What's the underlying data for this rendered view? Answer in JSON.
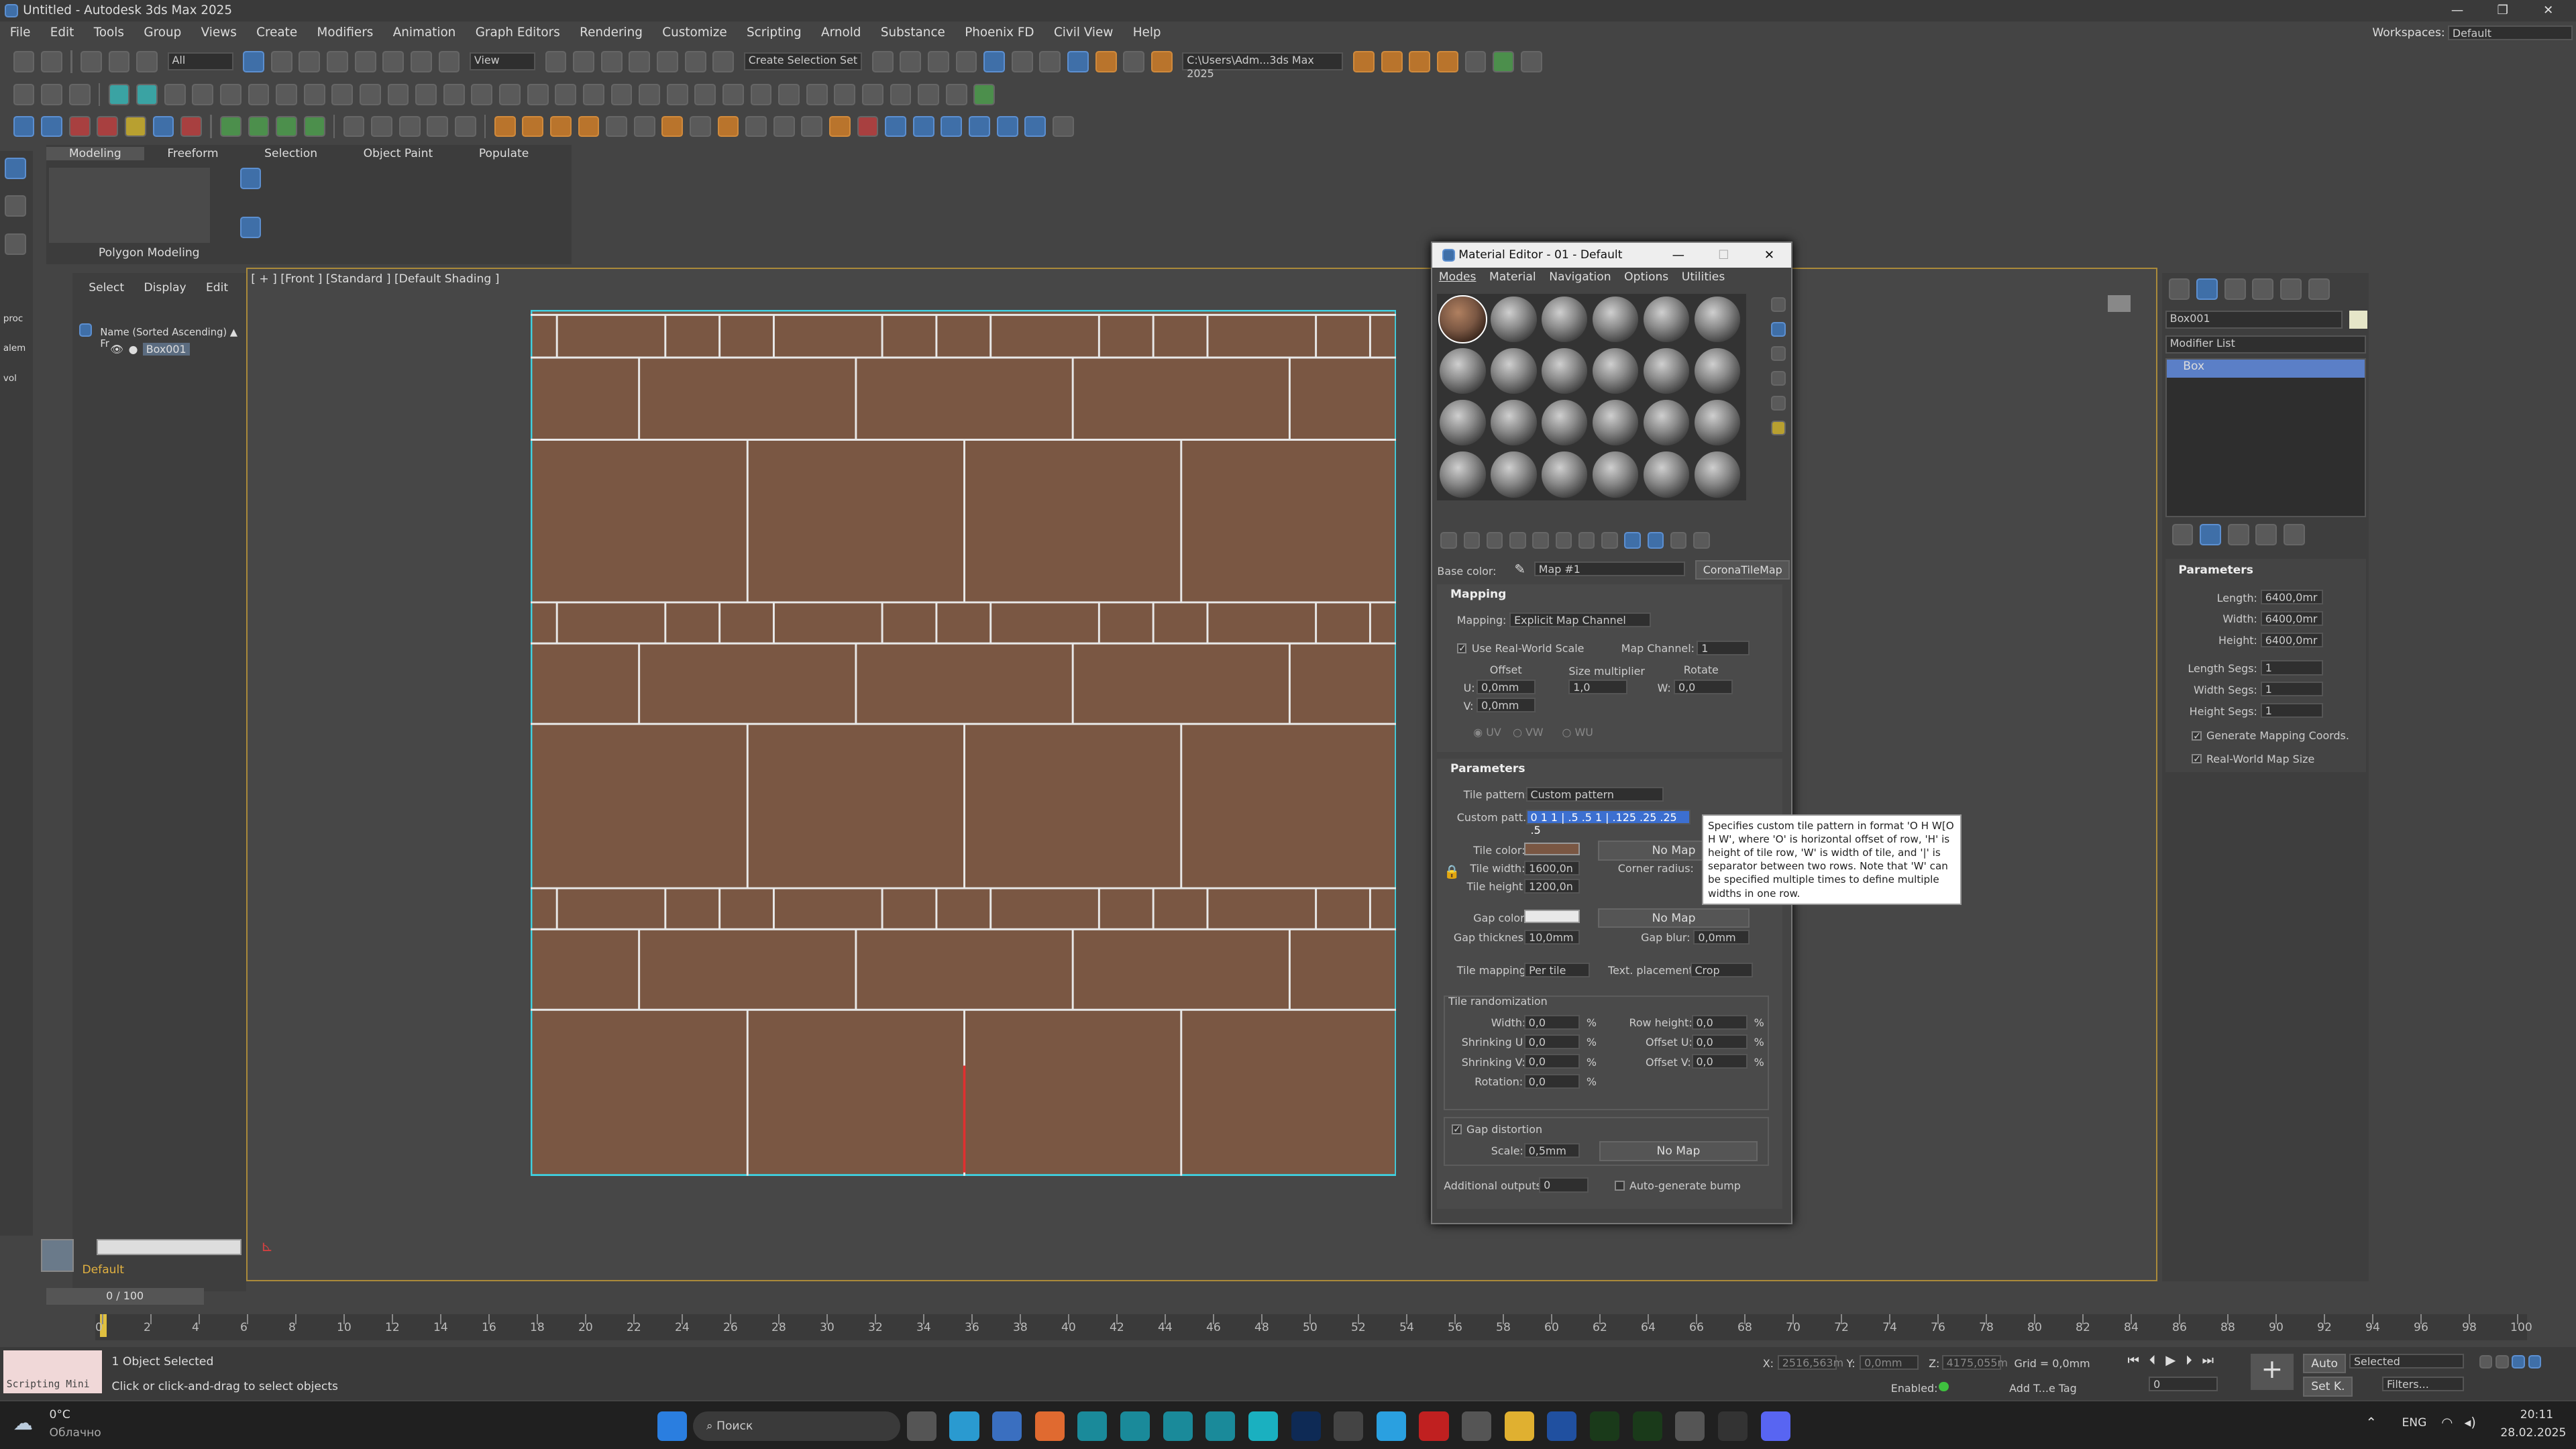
{
  "app": {
    "title": "Untitled - Autodesk 3ds Max 2025",
    "workspace_label": "Workspaces:",
    "workspace_value": "Default"
  },
  "menu": [
    "File",
    "Edit",
    "Tools",
    "Group",
    "Views",
    "Create",
    "Modifiers",
    "Animation",
    "Graph Editors",
    "Rendering",
    "Customize",
    "Scripting",
    "Arnold",
    "Substance",
    "Phoenix FD",
    "Civil View",
    "Help"
  ],
  "toolbar": {
    "filter_value": "All",
    "view_value": "View",
    "selection_set": "Create Selection Set",
    "path_value": "C:\\Users\\Adm...3ds Max 2025"
  },
  "ribbon": {
    "tabs": [
      "Modeling",
      "Freeform",
      "Selection",
      "Object Paint",
      "Populate"
    ],
    "panel_label": "Polygon Modeling"
  },
  "left_strip": [
    "proc",
    "alem",
    "vol"
  ],
  "scene_explorer": {
    "menu": [
      "Select",
      "Display",
      "Edit"
    ],
    "column": "Name (Sorted Ascending) ▲ Fr",
    "item": "Box001",
    "layer_label": "Default"
  },
  "viewport": {
    "label": "[ + ] [Front ] [Standard ] [Default Shading ]",
    "tile_color": "#7a5743",
    "gap_color": "#e8e8e8"
  },
  "mat_editor": {
    "title": "Material Editor - 01 - Default",
    "menu": [
      "Modes",
      "Material",
      "Navigation",
      "Options",
      "Utilities"
    ],
    "base_label": "Base color:",
    "map_name": "Map #1",
    "map_type": "CoronaTileMap",
    "mapping": {
      "header": "Mapping",
      "mapping_label": "Mapping:",
      "mapping_value": "Explicit Map Channel",
      "rws_label": "Use Real-World Scale",
      "channel_label": "Map Channel:",
      "channel_value": "1",
      "offset_label": "Offset",
      "size_label": "Size multiplier",
      "rotate_label": "Rotate",
      "u_label": "U:",
      "u_value": "0,0mm",
      "v_label": "V:",
      "v_value": "0,0mm",
      "size_value": "1,0",
      "w_label": "W:",
      "w_value": "0,0",
      "uv": "UV",
      "vw": "VW",
      "wu": "WU"
    },
    "params": {
      "header": "Parameters",
      "pattern_label": "Tile pattern:",
      "pattern_value": "Custom pattern",
      "custom_label": "Custom patt..",
      "custom_value": "0 1 1 | .5 .5 1 | .125 .25 .25 .5",
      "tooltip": "Specifies custom tile pattern in format 'O H W[O H W', where 'O' is horizontal offset of row, 'H' is height of tile row, 'W' is width of tile, and '|' is separator between two rows. Note that 'W' can be specified multiple times to define multiple widths in one row.",
      "tile_color_label": "Tile color:",
      "no_map": "No Map",
      "tile_width_label": "Tile width:",
      "tile_width_value": "1600,0n",
      "corner_label": "Corner radius:",
      "tile_height_label": "Tile height:",
      "tile_height_value": "1200,0n",
      "gap_color_label": "Gap color:",
      "gap_thick_label": "Gap thickness:",
      "gap_thick_value": "10,0mm",
      "gap_blur_label": "Gap blur:",
      "gap_blur_value": "0,0mm",
      "tile_map_label": "Tile mapping:",
      "tile_map_value": "Per tile",
      "text_place_label": "Text. placement:",
      "text_place_value": "Crop",
      "rand_header": "Tile randomization",
      "width_label": "Width:",
      "width_value": "0,0",
      "row_h_label": "Row height:",
      "row_h_value": "0,0",
      "shrink_u_label": "Shrinking U:",
      "shrink_u_value": "0,0",
      "offset_u_label": "Offset U:",
      "offset_u_value": "0,0",
      "shrink_v_label": "Shrinking V:",
      "shrink_v_value": "0,0",
      "offset_v_label": "Offset V:",
      "offset_v_value": "0,0",
      "rotation_label": "Rotation:",
      "rotation_value": "0,0",
      "pct": "%",
      "distortion_label": "Gap distortion",
      "scale_label": "Scale:",
      "scale_value": "0,5mm",
      "outputs_label": "Additional outputs:",
      "outputs_value": "0",
      "autobump_label": "Auto-generate bump"
    }
  },
  "command_panel": {
    "object_name": "Box001",
    "modifier_list": "Modifier List",
    "stack_item": "Box",
    "params_header": "Parameters",
    "length_label": "Length:",
    "length_value": "6400,0mr",
    "width_label": "Width:",
    "width_value": "6400,0mr",
    "height_label": "Height:",
    "height_value": "6400,0mr",
    "lsegs_label": "Length Segs:",
    "lsegs_value": "1",
    "wsegs_label": "Width Segs:",
    "wsegs_value": "1",
    "hsegs_label": "Height Segs:",
    "hsegs_value": "1",
    "gen_map": "Generate Mapping Coords.",
    "rwms": "Real-World Map Size"
  },
  "timeline": {
    "frame": "0 / 100",
    "ticks": [
      "0",
      "2",
      "4",
      "6",
      "8",
      "10",
      "12",
      "14",
      "16",
      "18",
      "20",
      "22",
      "24",
      "26",
      "28",
      "30",
      "32",
      "34",
      "36",
      "38",
      "40",
      "42",
      "44",
      "46",
      "48",
      "50",
      "52",
      "54",
      "56",
      "58",
      "60",
      "62",
      "64",
      "66",
      "68",
      "70",
      "72",
      "74",
      "76",
      "78",
      "80",
      "82",
      "84",
      "86",
      "88",
      "90",
      "92",
      "94",
      "96",
      "98",
      "100"
    ]
  },
  "status": {
    "script_label": "Scripting Mini",
    "selected": "1 Object Selected",
    "prompt": "Click or click-and-drag to select objects",
    "x_label": "X:",
    "x_value": "2516,563m",
    "y_label": "Y:",
    "y_value": "0,0mm",
    "z_label": "Z:",
    "z_value": "4175,055m",
    "grid": "Grid = 0,0mm",
    "enabled": "Enabled:",
    "addtag": "Add T...e Tag",
    "auto": "Auto",
    "setk": "Set K.",
    "selected_mode": "Selected",
    "filters": "Filters...",
    "frame_value": "0"
  },
  "taskbar": {
    "weather_temp": "0°C",
    "weather_desc": "Облачно",
    "search": "Поиск",
    "lang": "ENG",
    "time": "20:11",
    "date": "28.02.2025"
  }
}
